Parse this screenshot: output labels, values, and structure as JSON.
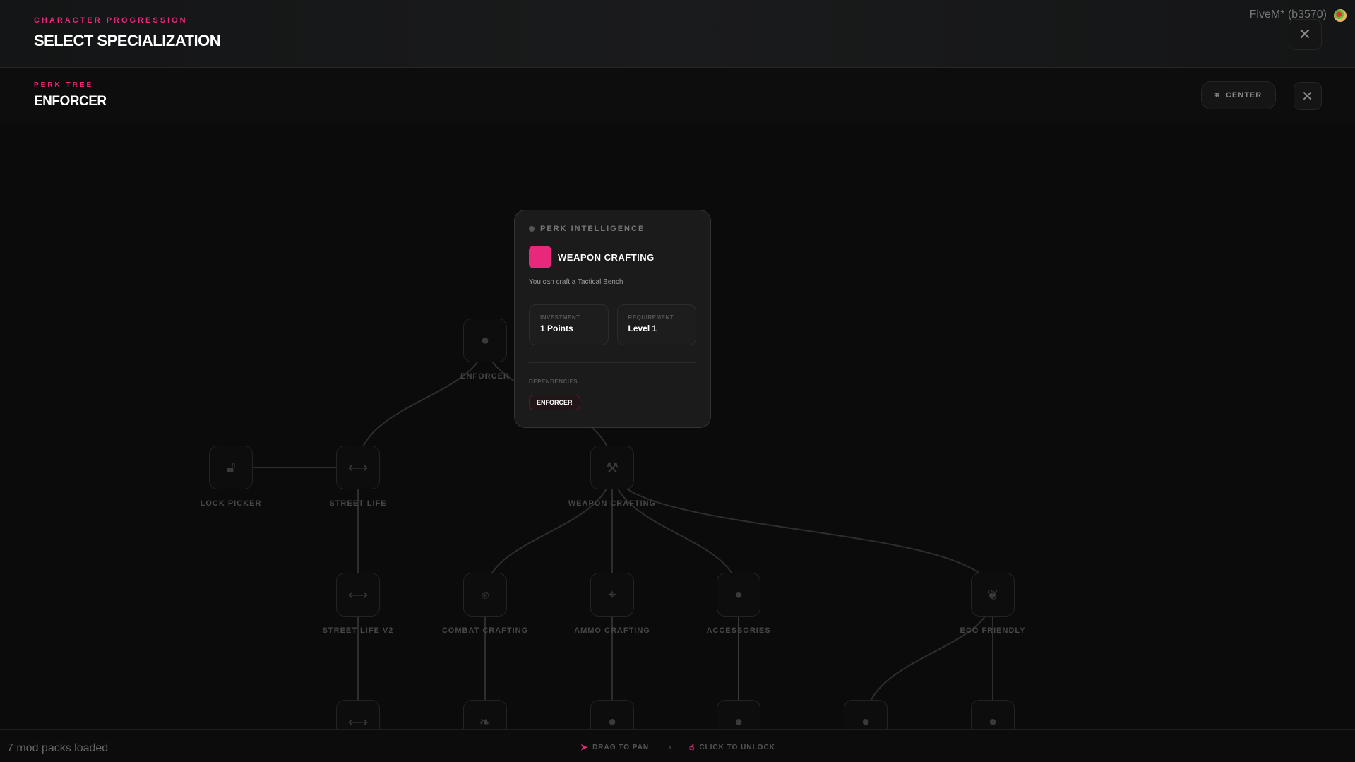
{
  "header": {
    "eyebrow": "CHARACTER PROGRESSION",
    "title": "SELECT SPECIALIZATION",
    "app_title": "FiveM* (b3570)"
  },
  "perk_bar": {
    "eyebrow": "PERK TREE",
    "title": "ENFORCER",
    "center_label": "CENTER"
  },
  "nodes": {
    "enforcer": "ENFORCER",
    "lock_picker": "LOCK PICKER",
    "street_life": "STREET LIFE",
    "weapon_crafting": "WEAPON CRAFTING",
    "street_life_v2": "STREET LIFE V2",
    "combat_crafting": "COMBAT CRAFTING",
    "ammo_crafting": "AMMO CRAFTING",
    "accessories": "ACCESSORIES",
    "eco_friendly": "ECO FRIENDLY"
  },
  "card": {
    "header": "PERK INTELLIGENCE",
    "name": "WEAPON CRAFTING",
    "description": "You can craft a Tactical Bench",
    "investment_label": "INVESTMENT",
    "investment_value": "1 Points",
    "requirement_label": "REQUIREMENT",
    "requirement_value": "Level 1",
    "dependencies_label": "DEPENDENCIES",
    "dependencies": [
      "ENFORCER"
    ],
    "color": "#e8287a"
  },
  "footer": {
    "status": "7 mod packs loaded",
    "hint_drag": "DRAG TO PAN",
    "hint_click": "CLICK TO UNLOCK"
  }
}
